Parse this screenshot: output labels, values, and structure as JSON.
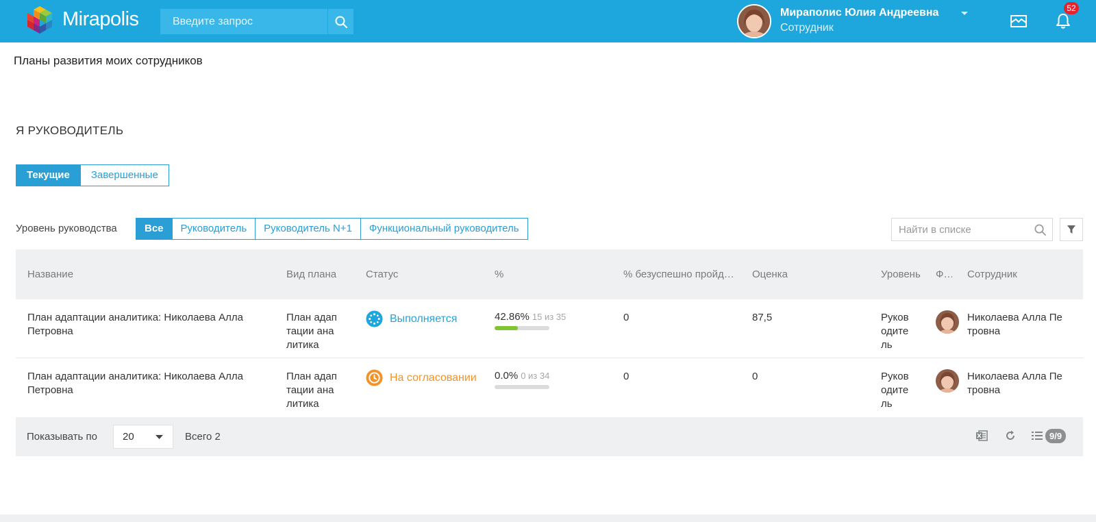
{
  "header": {
    "brand": "Mirapolis",
    "search_placeholder": "Введите запрос",
    "user_name": "Мираполис Юлия Андреевна",
    "user_role": "Сотрудник",
    "notifications_count": "52"
  },
  "page": {
    "title": "Планы развития моих сотрудников",
    "section_title": "Я РУКОВОДИТЕЛЬ"
  },
  "tabs": [
    {
      "label": "Текущие",
      "active": true
    },
    {
      "label": "Завершенные",
      "active": false
    }
  ],
  "filters": {
    "level_label": "Уровень руководства",
    "levels": [
      {
        "label": "Все",
        "active": true
      },
      {
        "label": "Руководитель",
        "active": false
      },
      {
        "label": "Руководитель N+1",
        "active": false
      },
      {
        "label": "Функциональный руководитель",
        "active": false
      }
    ],
    "list_search_placeholder": "Найти в списке"
  },
  "table": {
    "columns": [
      "Название",
      "Вид плана",
      "Статус",
      "%",
      "% безуспешно пройденных",
      "Оценка",
      "Уровень",
      "Фото",
      "Сотрудник"
    ],
    "rows": [
      {
        "name_line1": "План адаптации аналитика: Николаева Алла",
        "name_line2": "Петровна",
        "plan_type": [
          "План адап",
          "тации ана",
          "литика"
        ],
        "status": "Выполняется",
        "status_color": "#1ea7dd",
        "percent": "42.86%",
        "progress_text": "15 из 35",
        "progress": 0.4286,
        "failed_percent": "0",
        "score": "87,5",
        "level": [
          "Руков",
          "одите",
          "ль"
        ],
        "employee": [
          "Николаева Алла Пе",
          "тровна"
        ]
      },
      {
        "name_line1": "План адаптации аналитика: Николаева Алла",
        "name_line2": "Петровна",
        "plan_type": [
          "План адап",
          "тации ана",
          "литика"
        ],
        "status": "На согласовании",
        "status_color": "#f39325",
        "percent": "0.0%",
        "progress_text": "0 из 34",
        "progress": 0,
        "failed_percent": "0",
        "score": "0",
        "level": [
          "Руков",
          "одите",
          "ль"
        ],
        "employee": [
          "Николаева Алла Пе",
          "тровна"
        ]
      }
    ]
  },
  "footer": {
    "show_label": "Показывать по",
    "page_size": "20",
    "total": "Всего 2",
    "columns_badge": "9/9"
  },
  "colors": {
    "header_bg": "#1ea7dd",
    "accent": "#2a9fd6",
    "progress_fill": "#7ec52f",
    "badge": "#e5232d"
  }
}
